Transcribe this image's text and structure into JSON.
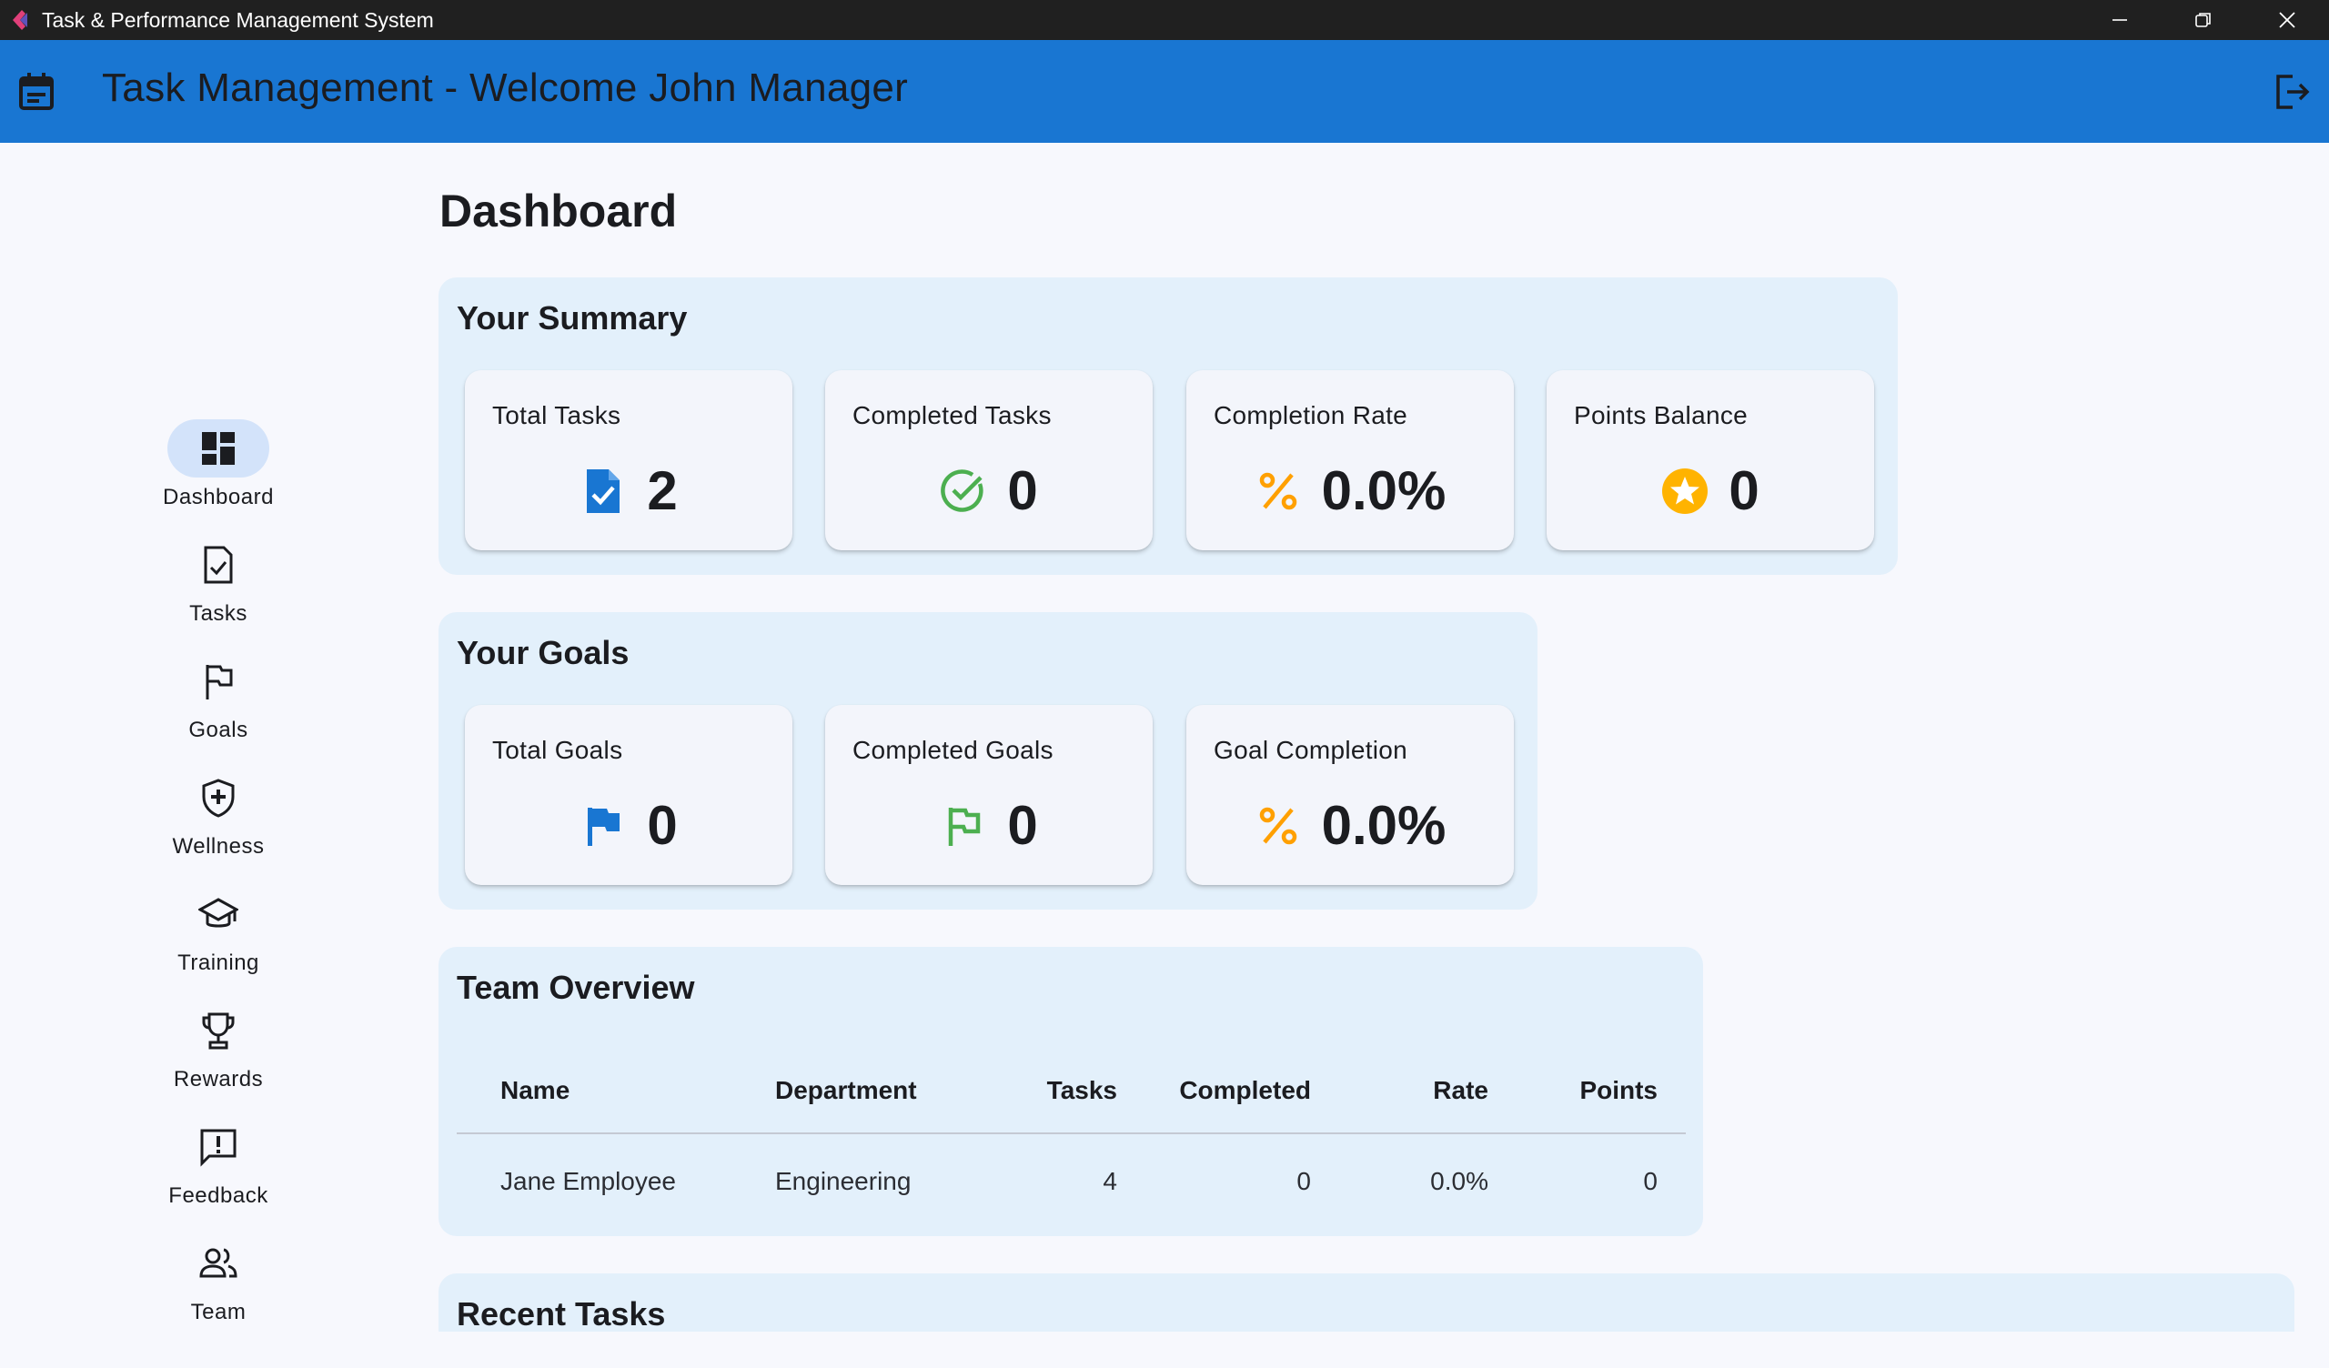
{
  "window": {
    "title": "Task & Performance Management System"
  },
  "appbar": {
    "title": "Task Management - Welcome John Manager"
  },
  "sidebar": {
    "items": [
      {
        "label": "Dashboard",
        "icon": "dashboard-icon",
        "active": true
      },
      {
        "label": "Tasks",
        "icon": "task-icon"
      },
      {
        "label": "Goals",
        "icon": "flag-icon"
      },
      {
        "label": "Wellness",
        "icon": "health-shield-icon"
      },
      {
        "label": "Training",
        "icon": "graduation-cap-icon"
      },
      {
        "label": "Rewards",
        "icon": "trophy-icon"
      },
      {
        "label": "Feedback",
        "icon": "feedback-icon"
      },
      {
        "label": "Team",
        "icon": "people-icon"
      }
    ]
  },
  "main": {
    "page_title": "Dashboard",
    "summary": {
      "title": "Your Summary",
      "cards": [
        {
          "label": "Total Tasks",
          "value": "2",
          "icon": "task-document-icon",
          "color": "#1976d2"
        },
        {
          "label": "Completed Tasks",
          "value": "0",
          "icon": "check-circle-icon",
          "color": "#4caf50"
        },
        {
          "label": "Completion Rate",
          "value": "0.0%",
          "icon": "percent-icon",
          "color": "#ffa000"
        },
        {
          "label": "Points Balance",
          "value": "0",
          "icon": "star-circle-icon",
          "color": "#ffb300"
        }
      ]
    },
    "goals": {
      "title": "Your Goals",
      "cards": [
        {
          "label": "Total Goals",
          "value": "0",
          "icon": "flag-filled-icon",
          "color": "#1976d2"
        },
        {
          "label": "Completed Goals",
          "value": "0",
          "icon": "flag-outline-icon",
          "color": "#4caf50"
        },
        {
          "label": "Goal Completion",
          "value": "0.0%",
          "icon": "percent-icon",
          "color": "#ffa000"
        }
      ]
    },
    "team_overview": {
      "title": "Team Overview",
      "columns": [
        "Name",
        "Department",
        "Tasks",
        "Completed",
        "Rate",
        "Points"
      ],
      "rows": [
        [
          "Jane Employee",
          "Engineering",
          "4",
          "0",
          "0.0%",
          "0"
        ]
      ]
    },
    "recent_tasks": {
      "title": "Recent Tasks"
    }
  }
}
